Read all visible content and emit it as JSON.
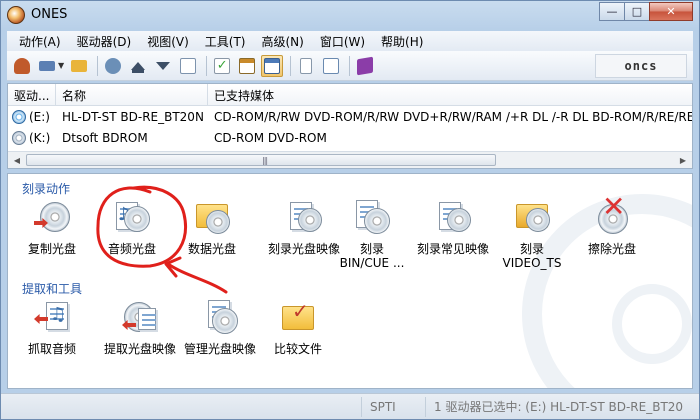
{
  "window": {
    "title": "ONES",
    "buttons": {
      "minimize": "—",
      "maximize": "□",
      "close": "✕"
    }
  },
  "menu": [
    {
      "label": "动作(A)"
    },
    {
      "label": "驱动器(D)"
    },
    {
      "label": "视图(V)"
    },
    {
      "label": "工具(T)"
    },
    {
      "label": "高级(N)"
    },
    {
      "label": "窗口(W)"
    },
    {
      "label": "帮助(H)"
    }
  ],
  "toolbar": {
    "logo": "oncs",
    "buttons": [
      {
        "icon": "burn-wizard-icon",
        "color": "#c05a2b"
      },
      {
        "icon": "disc-type-icon",
        "color": "#5b7fb3",
        "dropdown": true
      },
      {
        "icon": "open-folder-icon",
        "color": "#e9b43a"
      },
      {
        "icon": "search-drive-icon",
        "color": "#6b8fb7"
      },
      {
        "icon": "eject-icon",
        "color": "#3d4f66"
      },
      {
        "icon": "load-tray-icon",
        "color": "#3d4f66"
      },
      {
        "icon": "properties-icon",
        "color": "#7d93ad"
      },
      {
        "icon": "verify-icon",
        "color": "#3aa53a"
      },
      {
        "icon": "view-details-icon",
        "color": "#c98a2a"
      },
      {
        "icon": "view-panel-icon",
        "color": "#4d7ab8",
        "active": true
      },
      {
        "icon": "notes-icon",
        "color": "#8898aa"
      },
      {
        "icon": "edit-icon",
        "color": "#6a8ab0"
      },
      {
        "icon": "help-book-icon",
        "color": "#8b3da8"
      }
    ]
  },
  "drives": {
    "columns": [
      "驱动...",
      "名称",
      "已支持媒体"
    ],
    "rows": [
      {
        "letter": "(E:)",
        "name": "HL-DT-ST BD-RE_BT20N",
        "media": "CD-ROM/R/RW DVD-ROM/R/RW DVD+R/RW/RAM /+R DL /-R DL  BD-ROM/R/RE/RE",
        "selected": true
      },
      {
        "letter": "(K:)",
        "name": "Dtsoft BDROM",
        "media": "CD-ROM DVD-ROM",
        "selected": false
      }
    ],
    "scroll_grip": "|||"
  },
  "sections": {
    "burn": {
      "title": "刻录动作",
      "items": [
        {
          "label": "复制光盘"
        },
        {
          "label": "音频光盘"
        },
        {
          "label": "数据光盘"
        },
        {
          "label": "刻录光盘映像"
        },
        {
          "label": "刻录",
          "label2": "BIN/CUE ..."
        },
        {
          "label": "刻录常见映像"
        },
        {
          "label": "刻录",
          "label2": "VIDEO_TS"
        },
        {
          "label": "擦除光盘"
        }
      ]
    },
    "extract": {
      "title": "提取和工具",
      "items": [
        {
          "label": "抓取音频"
        },
        {
          "label": "提取光盘映像"
        },
        {
          "label": "管理光盘映像"
        },
        {
          "label": "比较文件"
        }
      ]
    }
  },
  "statusbar": {
    "mode": "SPTI",
    "message": "1 驱动器已选中: (E:) HL-DT-ST BD-RE_BT20"
  },
  "colors": {
    "annotation": "#e0201b",
    "section_title": "#2a5aa8"
  }
}
